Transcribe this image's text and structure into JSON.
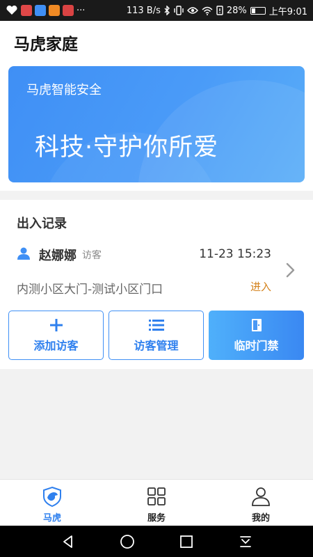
{
  "status_bar": {
    "network_speed": "113 B/s",
    "battery": "28%",
    "time": "上午9:01",
    "overflow": "···"
  },
  "header": {
    "title": "马虎家庭"
  },
  "banner": {
    "subtitle": "马虎智能安全",
    "slogan": "科技·守护你所爱"
  },
  "records": {
    "title": "出入记录",
    "entry": {
      "name": "赵娜娜",
      "tag": "访客",
      "time": "11-23 15:23",
      "gate": "内测小区大门-测试小区门口",
      "direction": "进入"
    }
  },
  "actions": {
    "add_visitor": "添加访客",
    "visitor_manage": "访客管理",
    "temp_access": "临时门禁"
  },
  "tabbar": {
    "tabs": [
      {
        "label": "马虎",
        "icon": "mahu-logo-icon",
        "active": true
      },
      {
        "label": "服务",
        "icon": "grid-icon",
        "active": false
      },
      {
        "label": "我的",
        "icon": "user-icon",
        "active": false
      }
    ]
  },
  "colors": {
    "accent": "#3f8ff5",
    "direction": "#d4821c"
  }
}
